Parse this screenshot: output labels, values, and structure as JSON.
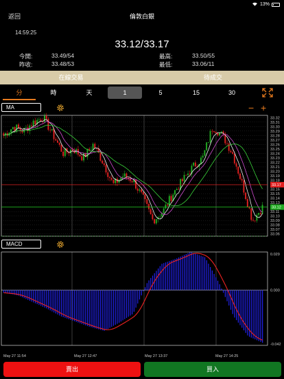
{
  "status_bar": {
    "wifi_icon": "wifi-icon",
    "battery_text": "13%",
    "battery_icon": "battery-charging-icon"
  },
  "nav": {
    "back": "返回",
    "title": "倫敦白銀"
  },
  "quote": {
    "time": "14:59:25",
    "bid_ask": "33.12/33.17",
    "open_label": "今開:",
    "open_value": "33.49/54",
    "prevclose_label": "昨收:",
    "prevclose_value": "33.48/53",
    "high_label": "最高:",
    "high_value": "33.50/55",
    "low_label": "最低:",
    "low_value": "33.06/11"
  },
  "trade_tabs": {
    "online": "在線交易",
    "pending": "待成交"
  },
  "period_tabs": [
    "分",
    "時",
    "天",
    "1",
    "5",
    "15",
    "30"
  ],
  "colors": {
    "accent": "#e67a1e",
    "up": "#22aa22",
    "down": "#e02020",
    "sell": "#ee1111",
    "buy": "#117722"
  },
  "main_chart": {
    "indicator": "MA",
    "price_labels": [
      "33.32",
      "33.31",
      "33.30",
      "33.29",
      "33.28",
      "33.27",
      "33.26",
      "33.25",
      "33.24",
      "33.23",
      "33.22",
      "33.21",
      "33.20",
      "33.19",
      "33.18",
      "33.17",
      "33.16",
      "33.15",
      "33.14",
      "33.13",
      "33.12",
      "33.11",
      "33.10",
      "33.09",
      "33.08",
      "33.07",
      "33.06"
    ],
    "ask_price": "33.17",
    "bid_price": "33.12",
    "ylim": [
      33.055,
      33.325
    ]
  },
  "sub_chart": {
    "indicator": "MACD",
    "labels": [
      "0.029",
      "0.000",
      "-0.042"
    ],
    "ylim": [
      -0.042,
      0.029
    ]
  },
  "x_labels": [
    "May 27 11:54",
    "May 27 12:47",
    "May 27 13:37",
    "May 27 14:25"
  ],
  "chart_data": {
    "type": "candlestick",
    "anchor_closes": [
      33.28,
      33.3,
      33.29,
      33.31,
      33.32,
      33.28,
      33.24,
      33.25,
      33.23,
      33.26,
      33.22,
      33.17,
      33.19,
      33.18,
      33.14,
      33.09,
      33.11,
      33.15,
      33.18,
      33.21,
      33.23,
      33.3,
      33.28,
      33.24,
      33.17,
      33.09,
      33.12
    ],
    "macd_anchors": [
      -0.002,
      -0.004,
      -0.009,
      -0.014,
      -0.02,
      -0.024,
      -0.028,
      -0.031,
      -0.025,
      -0.018,
      0.006,
      0.02,
      0.024,
      0.029,
      0.025,
      0.005,
      -0.02,
      -0.035,
      -0.04
    ]
  },
  "actions": {
    "sell": "賣出",
    "buy": "買入"
  }
}
